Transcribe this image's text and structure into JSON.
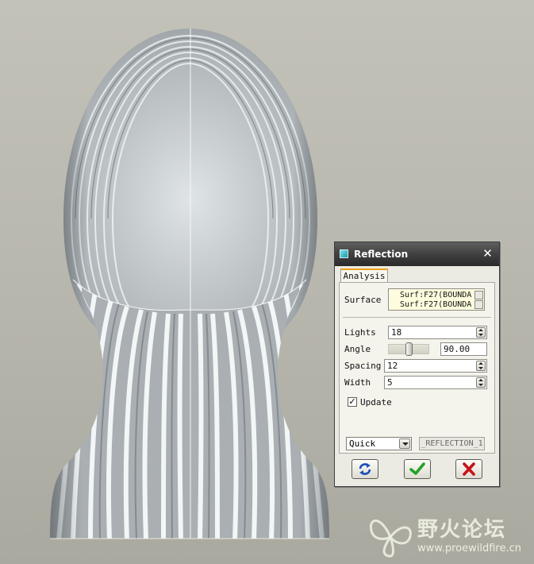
{
  "dialog": {
    "title": "Reflection",
    "tab_label": "Analysis",
    "surface_label": "Surface",
    "surface_items": [
      "Surf:F27(BOUNDA",
      "Surf:F27(BOUNDA"
    ],
    "lights_label": "Lights",
    "lights_value": "18",
    "angle_label": "Angle",
    "angle_value": "90.00",
    "angle_slider_fraction": 0.5,
    "spacing_label": "Spacing",
    "spacing_value": "12",
    "width_label": "Width",
    "width_value": "5",
    "update_label": "Update",
    "update_checked": true,
    "mode_value": "Quick",
    "result_name": "_REFLECTION_1"
  },
  "watermark": {
    "title": "野火论坛",
    "url": "www.proewildfire.cn"
  },
  "icons": {
    "title": "reflection-icon",
    "close": "close-icon",
    "repeat": "repeat-icon",
    "ok": "checkmark-icon",
    "cancel": "cancel-icon"
  },
  "colors": {
    "ok_green": "#21a324",
    "cancel_red": "#c8121a",
    "repeat_blue": "#1d4fb8"
  }
}
